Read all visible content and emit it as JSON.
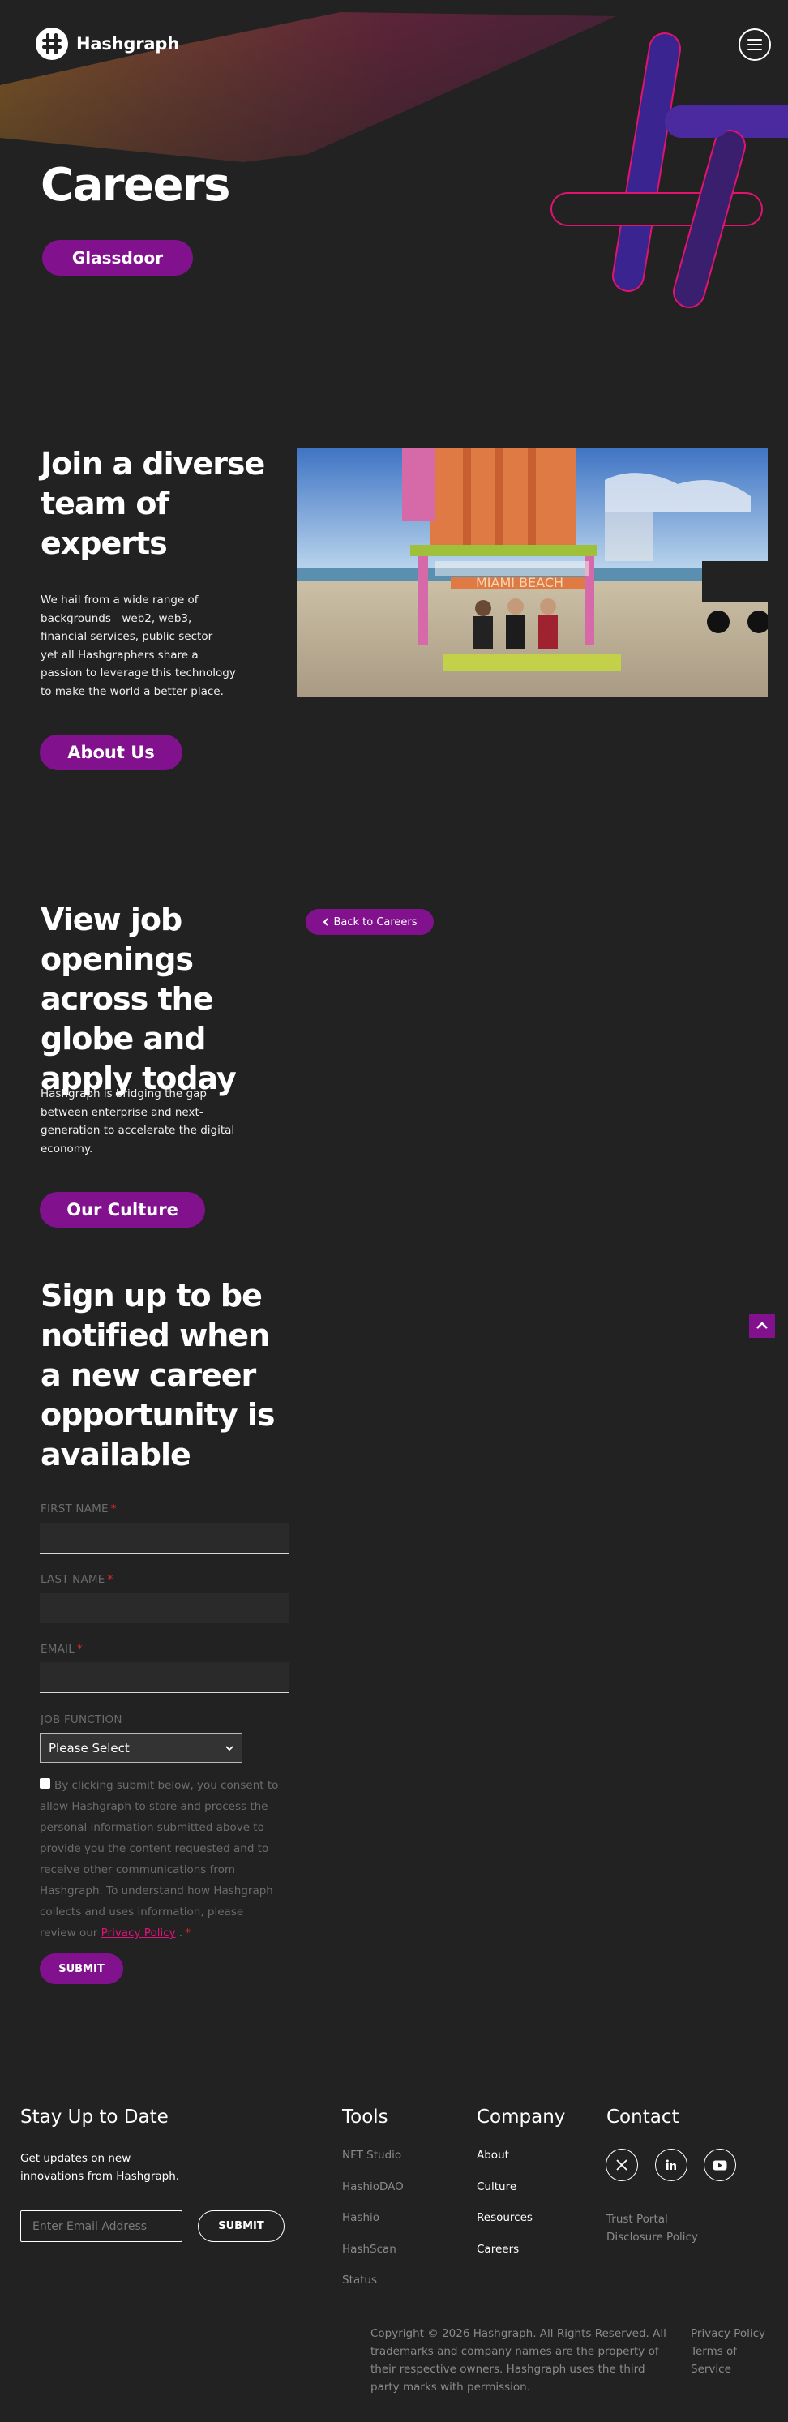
{
  "header": {
    "brand": "Hashgraph"
  },
  "hero": {
    "title": "Careers",
    "glassdoor_label": "Glassdoor"
  },
  "diverse": {
    "title": "Join a diverse team of experts",
    "text": "We hail from a wide range of backgrounds—web2, web3, financial services, public sector—yet all Hashgraphers share a passion to leverage this technology to make the world a better place.",
    "about_label": "About Us",
    "photo_sign": "MIAMI BEACH"
  },
  "jobs": {
    "title": "View job openings across the globe and apply today",
    "text": "Hashgraph is bridging the gap between enterprise and next-generation to accelerate the digital economy.",
    "culture_label": "Our Culture",
    "back_label": "Back to Careers"
  },
  "signup": {
    "title": "Sign up to be notified when a new career opportunity is available",
    "first_name_label": "FIRST NAME",
    "last_name_label": "LAST NAME",
    "email_label": "EMAIL",
    "required_mark": "*",
    "job_function_label": "JOB FUNCTION",
    "job_function_value": "Please Select",
    "consent_text": "By clicking submit below, you consent to allow Hashgraph to store and process the personal information submitted above to provide you the content requested and to receive other communications from Hashgraph. To understand how Hashgraph collects and uses information, please review our",
    "privacy_link": "Privacy Policy",
    "consent_end": ".",
    "submit_label": "SUBMIT"
  },
  "footer": {
    "stay_title": "Stay Up to Date",
    "stay_text": "Get updates on new innovations from Hashgraph.",
    "email_placeholder": "Enter Email Address",
    "submit_label": "SUBMIT",
    "tools_title": "Tools",
    "tools": [
      "NFT Studio",
      "HashioDAO",
      "Hashio",
      "HashScan",
      "Status"
    ],
    "company_title": "Company",
    "company": [
      "About",
      "Culture",
      "Resources",
      "Careers"
    ],
    "contact_title": "Contact",
    "contact_links": [
      "Trust Portal",
      "Disclosure Policy"
    ],
    "copyright": "Copyright © 2026 Hashgraph. All Rights Reserved. All trademarks and company names are the property of their respective owners. Hashgraph uses the third party marks with permission.",
    "legal": [
      "Privacy Policy",
      "Terms of Service"
    ]
  },
  "colors": {
    "background": "#222222",
    "accent": "#82118e",
    "link": "#e2127a"
  }
}
